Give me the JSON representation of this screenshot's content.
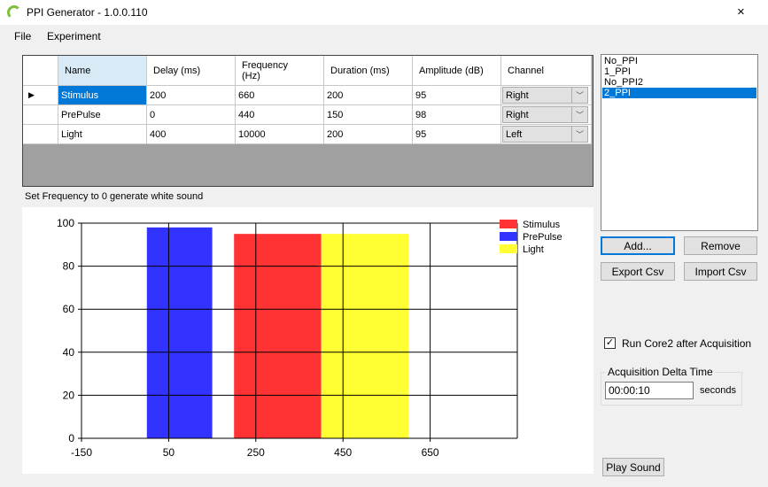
{
  "window": {
    "title": "PPI Generator - 1.0.0.110",
    "close_icon": "×"
  },
  "menu": [
    "File",
    "Experiment"
  ],
  "grid": {
    "columns": [
      "Name",
      "Delay (ms)",
      "Frequency\n(Hz)",
      "Duration (ms)",
      "Amplitude (dB)",
      "Channel"
    ],
    "rows": [
      {
        "name": "Stimulus",
        "delay": "200",
        "frequency": "660",
        "duration": "200",
        "amplitude": "95",
        "channel": "Right"
      },
      {
        "name": "PrePulse",
        "delay": "0",
        "frequency": "440",
        "duration": "150",
        "amplitude": "98",
        "channel": "Right"
      },
      {
        "name": "Light",
        "delay": "400",
        "frequency": "10000",
        "duration": "200",
        "amplitude": "95",
        "channel": "Left"
      }
    ],
    "current_row_indicator": "▶"
  },
  "hint": "Set Frequency to 0 generate white sound",
  "experiments": {
    "items": [
      "No_PPI",
      "1_PPI",
      "No_PPI2",
      "2_PPI"
    ],
    "selected": "2_PPI"
  },
  "buttons": {
    "add": "Add...",
    "remove": "Remove",
    "export": "Export Csv",
    "import": "Import Csv",
    "play": "Play Sound"
  },
  "options": {
    "run_core2_label": "Run Core2 after Acquisition",
    "run_core2_checked": true,
    "delta_group": "Acquisition Delta Time",
    "delta_value": "00:00:10",
    "delta_unit": "seconds"
  },
  "chart_data": {
    "type": "bar",
    "xlim": [
      -150,
      850
    ],
    "ylim": [
      0,
      100
    ],
    "xticks": [
      -150,
      50,
      250,
      450,
      650
    ],
    "yticks": [
      0,
      20,
      40,
      60,
      80,
      100
    ],
    "grid": true,
    "legend_position": "top-right",
    "series": [
      {
        "name": "Stimulus",
        "x_start": 200,
        "x_end": 400,
        "value": 95,
        "color": "#ff3333"
      },
      {
        "name": "PrePulse",
        "x_start": 0,
        "x_end": 150,
        "value": 98,
        "color": "#3333ff"
      },
      {
        "name": "Light",
        "x_start": 400,
        "x_end": 600,
        "value": 95,
        "color": "#ffff33"
      }
    ]
  }
}
